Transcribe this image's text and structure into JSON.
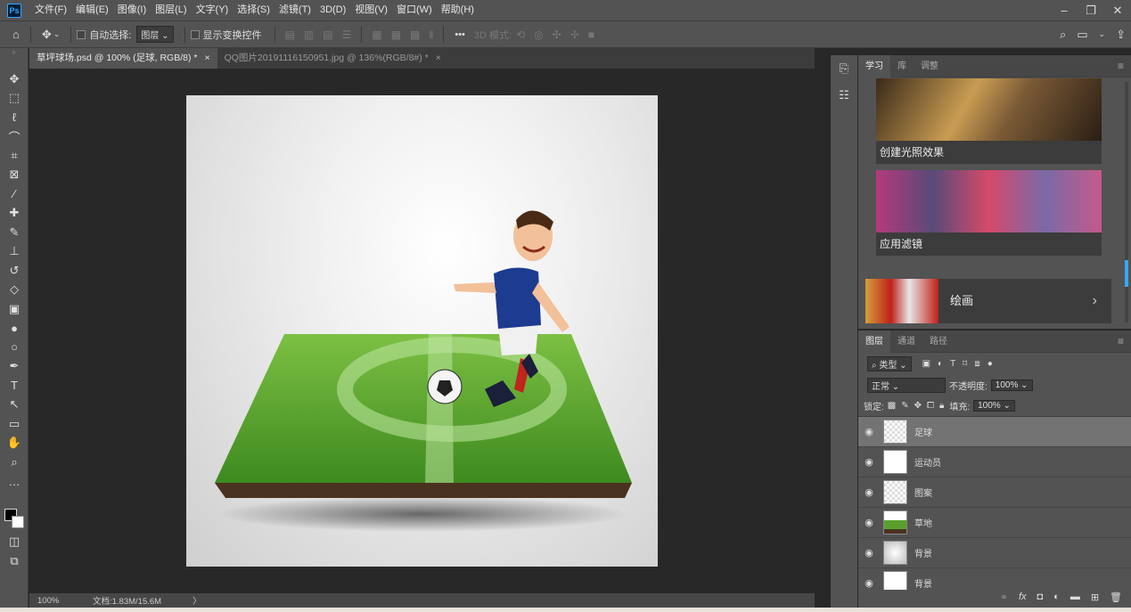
{
  "app": {
    "logo": "Ps"
  },
  "menu": [
    "文件(F)",
    "编辑(E)",
    "图像(I)",
    "图层(L)",
    "文字(Y)",
    "选择(S)",
    "滤镜(T)",
    "3D(D)",
    "视图(V)",
    "窗口(W)",
    "帮助(H)"
  ],
  "window_controls": [
    "minimize-icon",
    "restore-icon",
    "close-icon"
  ],
  "options": {
    "auto_select_label": "自动选择:",
    "auto_select_value": "图层",
    "show_transform_label": "显示变换控件",
    "mode_3d_label": "3D 模式:",
    "more": "•••"
  },
  "tabs": [
    {
      "title": "草坪球场.psd @ 100% (足球, RGB/8) *",
      "close": "×",
      "active": true
    },
    {
      "title": "QQ图片20191116150951.jpg @ 136%(RGB/8#) *",
      "close": "×",
      "active": false
    }
  ],
  "status": {
    "zoom": "100%",
    "doc": "文档:1.83M/15.6M",
    "arrow": "〉"
  },
  "tools": [
    "move-icon",
    "marquee-icon",
    "lasso-icon",
    "quick-select-icon",
    "crop-icon",
    "frame-icon",
    "eyedropper-icon",
    "healing-icon",
    "brush-icon",
    "stamp-icon",
    "history-brush-icon",
    "eraser-icon",
    "gradient-icon",
    "blur-icon",
    "dodge-icon",
    "pen-icon",
    "type-icon",
    "path-select-icon",
    "rectangle-icon",
    "hand-icon",
    "zoom-icon",
    "more-tools-icon"
  ],
  "learn_panel": {
    "tabs": [
      "学习",
      "库",
      "调整"
    ],
    "cards": [
      {
        "label": "创建光照效果"
      },
      {
        "label": "应用滤镜"
      },
      {
        "label": "绘画",
        "chevron": "›"
      }
    ]
  },
  "layers_panel": {
    "tabs": [
      "图层",
      "通道",
      "路径"
    ],
    "filter_label": "类型",
    "blend_mode": "正常",
    "opacity_label": "不透明度:",
    "opacity": "100%",
    "lock_label": "锁定:",
    "fill_label": "填充:",
    "fill": "100%",
    "layers": [
      {
        "name": "足球",
        "selected": true
      },
      {
        "name": "运动员",
        "selected": false
      },
      {
        "name": "图案",
        "selected": false
      },
      {
        "name": "草地",
        "selected": false
      },
      {
        "name": "背景",
        "selected": false
      },
      {
        "name": "背景",
        "selected": false
      }
    ],
    "footer_fx": "fx"
  },
  "colors": {
    "accent": "#31a8ff",
    "panel": "#535353",
    "canvas_bg": "#282828",
    "grass": "#5aa02c"
  }
}
